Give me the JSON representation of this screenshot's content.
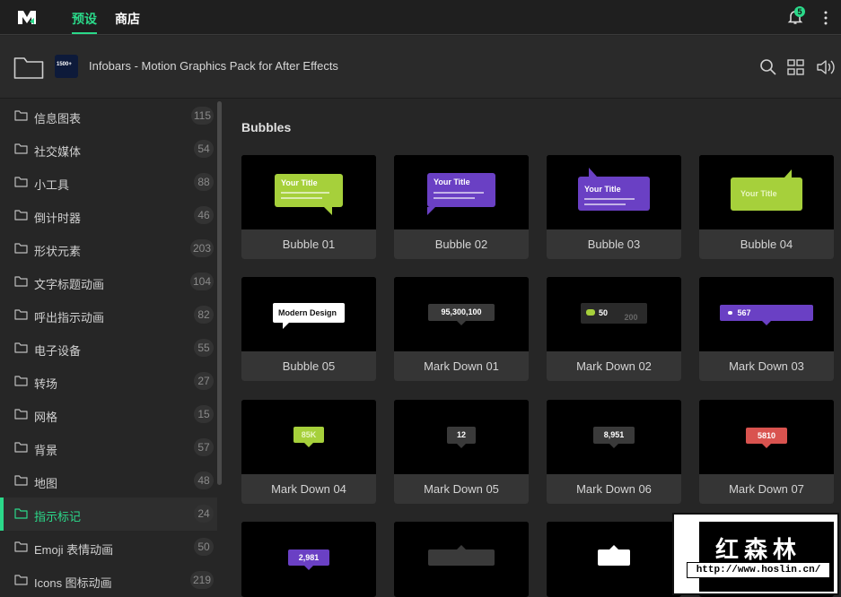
{
  "app": {
    "tabs": [
      {
        "label": "预设",
        "active": true
      },
      {
        "label": "商店",
        "active": false
      }
    ],
    "notification_count": "5",
    "accent_color": "#2bd98a"
  },
  "pack": {
    "title": "Infobars - Motion Graphics Pack for After Effects",
    "thumb_text": "1500+"
  },
  "sidebar": {
    "items": [
      {
        "label": "信息图表",
        "count": "115",
        "active": false
      },
      {
        "label": "社交媒体",
        "count": "54",
        "active": false
      },
      {
        "label": "小工具",
        "count": "88",
        "active": false
      },
      {
        "label": "倒计时器",
        "count": "46",
        "active": false
      },
      {
        "label": "形状元素",
        "count": "203",
        "active": false
      },
      {
        "label": "文字标题动画",
        "count": "104",
        "active": false
      },
      {
        "label": "呼出指示动画",
        "count": "82",
        "active": false
      },
      {
        "label": "电子设备",
        "count": "55",
        "active": false
      },
      {
        "label": "转场",
        "count": "27",
        "active": false
      },
      {
        "label": "网格",
        "count": "15",
        "active": false
      },
      {
        "label": "背景",
        "count": "57",
        "active": false
      },
      {
        "label": "地图",
        "count": "48",
        "active": false
      },
      {
        "label": "指示标记",
        "count": "24",
        "active": true
      },
      {
        "label": "Emoji 表情动画",
        "count": "50",
        "active": false
      },
      {
        "label": "Icons 图标动画",
        "count": "219",
        "active": false
      }
    ]
  },
  "main": {
    "section_title": "Bubbles",
    "cards": [
      {
        "label": "Bubble 01",
        "preview_text": "Your Title"
      },
      {
        "label": "Bubble 02",
        "preview_text": "Your Title"
      },
      {
        "label": "Bubble 03",
        "preview_text": "Your Title"
      },
      {
        "label": "Bubble 04",
        "preview_text": "Your Title"
      },
      {
        "label": "Bubble 05",
        "preview_text": "Modern Design"
      },
      {
        "label": "Mark Down 01",
        "preview_text": "95,300,100"
      },
      {
        "label": "Mark Down 02",
        "preview_text": "50",
        "preview_text2": "200"
      },
      {
        "label": "Mark Down 03",
        "preview_text": "567"
      },
      {
        "label": "Mark Down 04",
        "preview_text": "85K"
      },
      {
        "label": "Mark Down 05",
        "preview_text": "12"
      },
      {
        "label": "Mark Down 06",
        "preview_text": "8,951"
      },
      {
        "label": "Mark Down 07",
        "preview_text": "5810"
      },
      {
        "label": "",
        "preview_text": "2,981"
      },
      {
        "label": "",
        "preview_text": ""
      },
      {
        "label": "",
        "preview_text": ""
      },
      {
        "label": "",
        "preview_text": ""
      }
    ]
  },
  "watermark": {
    "cn_text": "红森林",
    "url": "http://www.hoslin.cn/"
  },
  "colors": {
    "green_bubble": "#a6d03b",
    "purple_bubble": "#6a40c4",
    "red_marker": "#d9534f",
    "dark_marker": "#3a3a3a"
  }
}
